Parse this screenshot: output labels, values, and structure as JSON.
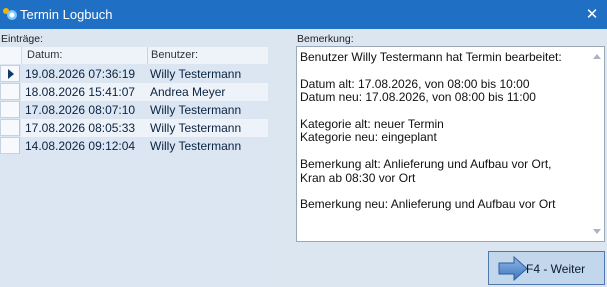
{
  "window": {
    "title": "Termin Logbuch",
    "close_glyph": "✕",
    "icon": "app-logo-icon"
  },
  "entries": {
    "label": "Einträge:",
    "columns": [
      "Datum:",
      "Benutzer:"
    ],
    "rows": [
      {
        "date": "19.08.2026 07:36:19",
        "user": "Willy Testermann",
        "selected": true
      },
      {
        "date": "18.08.2026 15:41:07",
        "user": "Andrea Meyer"
      },
      {
        "date": "17.08.2026 08:07:10",
        "user": "Willy Testermann"
      },
      {
        "date": "17.08.2026 08:05:33",
        "user": "Willy Testermann"
      },
      {
        "date": "14.08.2026 09:12:04",
        "user": "Willy Testermann"
      }
    ]
  },
  "remark": {
    "label": "Bemerkung:",
    "text": "Benutzer Willy Testermann hat Termin bearbeitet:\n\nDatum alt: 17.08.2026, von 08:00 bis 10:00\nDatum neu: 17.08.2026, von 08:00 bis 11:00\n\nKategorie alt: neuer Termin\nKategorie neu: eingeplant\n\nBemerkung alt: Anlieferung und Aufbau vor Ort,\nKran ab 08:30 vor Ort\n\nBemerkung neu: Anlieferung und Aufbau vor Ort"
  },
  "next_button": {
    "label": "F4 - Weiter",
    "icon": "arrow-right-icon"
  },
  "colors": {
    "titlebar": "#1f6fc5",
    "background": "#dce6f1",
    "button": "#c2d6ec"
  }
}
